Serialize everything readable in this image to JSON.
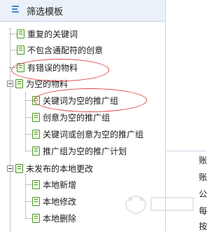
{
  "panel": {
    "title": "筛选模板",
    "menu_icon": "menu-icon"
  },
  "tree": {
    "items": [
      {
        "label": "重复的关键词",
        "level": 1,
        "icon": "page-icon"
      },
      {
        "label": "不包含通配符的创意",
        "level": 1,
        "icon": "page-icon"
      },
      {
        "label": "有错误的物料",
        "level": 1,
        "icon": "page-icon"
      },
      {
        "label": "为空的物料",
        "level": 0,
        "icon": "page-icon",
        "expanded": true
      },
      {
        "label": "关键词为空的推广组",
        "level": 2,
        "icon": "page-icon"
      },
      {
        "label": "创意为空的推广组",
        "level": 2,
        "icon": "page-icon"
      },
      {
        "label": "关键词或创意为空的推广组",
        "level": 2,
        "icon": "page-icon"
      },
      {
        "label": "推广组为空的推广计划",
        "level": 2,
        "icon": "page-icon"
      },
      {
        "label": "未发布的本地更改",
        "level": 0,
        "icon": "page-icon",
        "expanded": true
      },
      {
        "label": "本地新增",
        "level": 2,
        "icon": "page-icon"
      },
      {
        "label": "本地修改",
        "level": 2,
        "icon": "page-icon"
      },
      {
        "label": "本地删除",
        "level": 2,
        "icon": "page-icon"
      }
    ]
  },
  "right_pane": {
    "lines": [
      "账",
      "账",
      "公",
      "每",
      "按"
    ]
  },
  "colors": {
    "header_bg": "#eaf1f8",
    "icon_green": "#4e9a2e",
    "highlight_ellipse": "#e04646",
    "accent_blue": "#4a86c9"
  }
}
